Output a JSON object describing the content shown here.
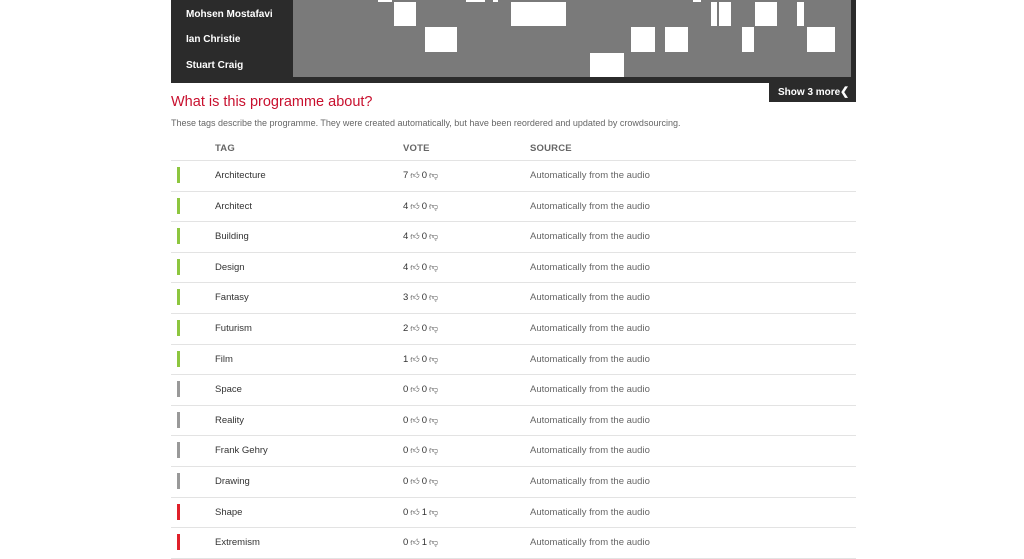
{
  "speakers": [
    {
      "name": "Mohsen Mostafavi"
    },
    {
      "name": "Ian Christie"
    },
    {
      "name": "Stuart Craig"
    }
  ],
  "show_more_label": "Show 3 more",
  "section": {
    "title": "What is this programme about?",
    "description": "These tags describe the programme. They were created automatically, but have been reordered and updated by crowdsourcing."
  },
  "table": {
    "headers": {
      "tag": "TAG",
      "vote": "VOTE",
      "source": "SOURCE"
    },
    "rows": [
      {
        "tag": "Architecture",
        "up": "7",
        "down": "0",
        "source": "Automatically from the audio",
        "status": "positive"
      },
      {
        "tag": "Architect",
        "up": "4",
        "down": "0",
        "source": "Automatically from the audio",
        "status": "positive"
      },
      {
        "tag": "Building",
        "up": "4",
        "down": "0",
        "source": "Automatically from the audio",
        "status": "positive"
      },
      {
        "tag": "Design",
        "up": "4",
        "down": "0",
        "source": "Automatically from the audio",
        "status": "positive"
      },
      {
        "tag": "Fantasy",
        "up": "3",
        "down": "0",
        "source": "Automatically from the audio",
        "status": "positive"
      },
      {
        "tag": "Futurism",
        "up": "2",
        "down": "0",
        "source": "Automatically from the audio",
        "status": "positive"
      },
      {
        "tag": "Film",
        "up": "1",
        "down": "0",
        "source": "Automatically from the audio",
        "status": "positive"
      },
      {
        "tag": "Space",
        "up": "0",
        "down": "0",
        "source": "Automatically from the audio",
        "status": "neutral"
      },
      {
        "tag": "Reality",
        "up": "0",
        "down": "0",
        "source": "Automatically from the audio",
        "status": "neutral"
      },
      {
        "tag": "Frank Gehry",
        "up": "0",
        "down": "0",
        "source": "Automatically from the audio",
        "status": "neutral"
      },
      {
        "tag": "Drawing",
        "up": "0",
        "down": "0",
        "source": "Automatically from the audio",
        "status": "neutral"
      },
      {
        "tag": "Shape",
        "up": "0",
        "down": "1",
        "source": "Automatically from the audio",
        "status": "negative"
      },
      {
        "tag": "Extremism",
        "up": "0",
        "down": "1",
        "source": "Automatically from the audio",
        "status": "negative"
      }
    ]
  },
  "colors": {
    "positive": "#8dc63f",
    "neutral": "#999999",
    "negative": "#e0202a",
    "title": "#c8102e"
  },
  "icons": {
    "upvote": "thumbs-up-icon",
    "downvote": "thumbs-down-icon",
    "show_more": "chevron-left-icon"
  }
}
